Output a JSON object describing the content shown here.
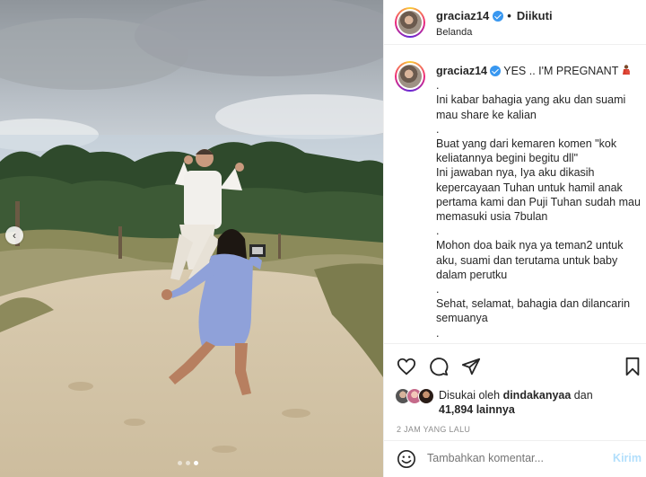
{
  "post_header": {
    "username": "graciaz14",
    "separator": "•",
    "follow_status": "Diikuti",
    "location": "Belanda",
    "more_icon": "more-horizontal-icon"
  },
  "caption": {
    "username": "graciaz14",
    "title_line": "YES .. I'M PREGNANT",
    "lines": [
      ".",
      "Ini kabar bahagia yang aku dan suami mau share ke kalian",
      ".",
      "Buat yang dari kemaren komen \"kok keliatannya begini begitu dll\"",
      "Ini jawaban nya, Iya aku dikasih kepercayaan Tuhan untuk hamil anak pertama kami dan Puji Tuhan sudah mau memasuki usia 7bulan",
      ".",
      "Mohon doa baik nya ya teman2 untuk aku, suami dan terutama untuk baby dalam perutku",
      ".",
      "Sehat, selamat, bahagia dan dilancarin semuanya",
      "."
    ]
  },
  "actions": {
    "like_icon": "heart-icon",
    "comment_icon": "comment-icon",
    "share_icon": "share-icon",
    "save_icon": "bookmark-icon"
  },
  "likes": {
    "prefix": "Disukai oleh",
    "liked_by": "dindakanyaa",
    "conjunction": "dan",
    "others_count": "41,894 lainnya"
  },
  "timestamp": "2 JAM YANG LALU",
  "comment": {
    "placeholder": "Tambahkan komentar...",
    "post_label": "Kirim"
  },
  "carousel": {
    "total_slides": 3,
    "active_slide": 3
  },
  "colors": {
    "verified": "#3897f0",
    "post_button_disabled": "#b2dffc",
    "text": "#262626",
    "muted": "#8e8e8e"
  }
}
